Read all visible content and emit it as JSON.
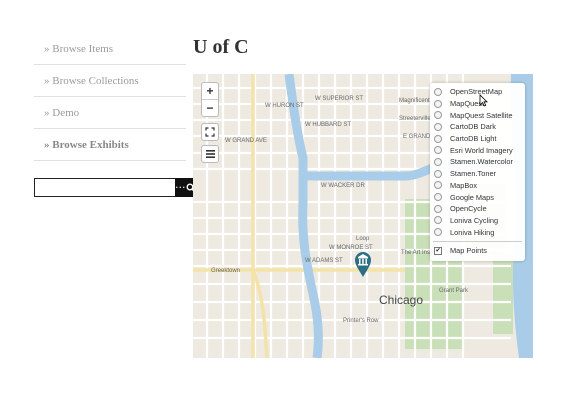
{
  "sidebar": {
    "items": [
      {
        "label": "» Browse Items"
      },
      {
        "label": "» Browse Collections"
      },
      {
        "label": "» Demo"
      },
      {
        "label": "» Browse Exhibits"
      }
    ]
  },
  "search": {
    "value": "",
    "options_label": "···"
  },
  "page": {
    "title": "U of C"
  },
  "map": {
    "zoom_in": "+",
    "zoom_out": "−",
    "city_label": "Chicago",
    "street_labels": [
      "W SUPERIOR ST",
      "W HURON ST",
      "W HUBBARD ST",
      "W GRAND AVE",
      "E GRAND AVE",
      "W WACKER DR",
      "W MONROE ST",
      "W ADAMS ST",
      "Magnificent Mile",
      "Streeterville",
      "Loop",
      "The Art Institute of Chicago",
      "Greektown",
      "Grant Park",
      "Printer's Row"
    ],
    "base_layers": [
      "OpenStreetMap",
      "MapQuest",
      "MapQuest Satellite",
      "CartoDB Dark",
      "CartoDB Light",
      "Esri World Imagery",
      "Stamen.Watercolor",
      "Stamen.Toner",
      "MapBox",
      "Google Maps",
      "OpenCycle",
      "Loniva Cycling",
      "Loniva Hiking"
    ],
    "overlay": {
      "label": "Map Points",
      "checked": true
    },
    "colors": {
      "water": "#a9cde8",
      "park": "#c9dfb8",
      "land": "#eeeae1",
      "road": "#ffffff",
      "marker": "#2a6f86"
    }
  }
}
